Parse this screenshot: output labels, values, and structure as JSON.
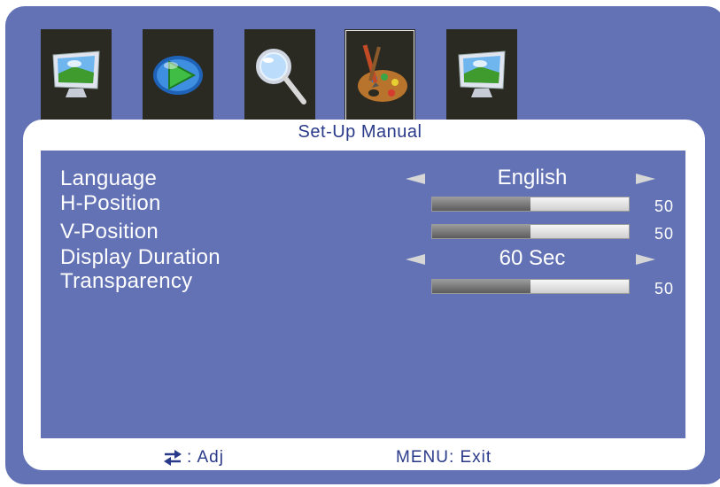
{
  "tabs": [
    {
      "name": "picture-monitor-icon",
      "selected": false
    },
    {
      "name": "play-arrow-icon",
      "selected": false
    },
    {
      "name": "magnifier-icon",
      "selected": false
    },
    {
      "name": "paint-palette-icon",
      "selected": true
    },
    {
      "name": "monitor-landscape-icon",
      "selected": false
    }
  ],
  "panel": {
    "title": "Set-Up Manual"
  },
  "settings": [
    {
      "label": "Language",
      "type": "select",
      "value": "English"
    },
    {
      "label": "H-Position",
      "type": "slider",
      "value": "50",
      "level": 0.5
    },
    {
      "label": "V-Position",
      "type": "slider",
      "value": "50",
      "level": 0.5
    },
    {
      "label": "Display Duration",
      "type": "select",
      "value": "60 Sec"
    },
    {
      "label": "Transparency",
      "type": "slider",
      "value": "50",
      "level": 0.5
    }
  ],
  "footer": {
    "adj_label": ": Adj",
    "exit_label": "MENU: Exit"
  },
  "colors": {
    "background": "#6272b5",
    "panel": "#ffffff",
    "title_text": "#2a3a8a",
    "tab_bg": "#2a2a23"
  }
}
